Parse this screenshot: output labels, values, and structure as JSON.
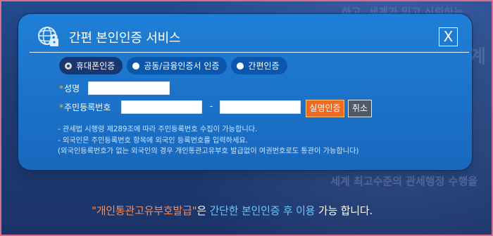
{
  "background": {
    "watermark_top": "하고, 세계가 믿고 신뢰하는",
    "watermark_right": "세계",
    "watermark_bottom": "세계 최고수준의 관세행정 수행을"
  },
  "dialog": {
    "title": "간편 본인인증 서비스",
    "close_label": "X",
    "tabs": [
      {
        "label": "휴대폰인증",
        "selected": true
      },
      {
        "label": "공동/금융인증서 인증",
        "selected": false
      },
      {
        "label": "간편인증",
        "selected": false
      }
    ],
    "fields": {
      "required_mark": "*",
      "name_label": "성명",
      "name_value": "",
      "rrn_label": "주민등록번호",
      "rrn_front_value": "",
      "rrn_separator": "-",
      "rrn_back_value": ""
    },
    "buttons": {
      "verify": "실명인증",
      "cancel": "취소"
    },
    "notes": [
      "- 관세법 시행령 제289조에 따라 주민등록번호 수집이 가능합니다.",
      "- 외국인은 주민등록번호 항목에 외국인 등록번호를 입력하세요.",
      "(외국인등록번호가 없는 외국인의 경우 개인통관고유부호 발급없이 여권번호로도 통관이 가능합니다)"
    ]
  },
  "bottom_message": {
    "highlight": "\"개인통관고유부호발급\"",
    "after_highlight": "은 ",
    "blue_text": "간단한 본인인증 후 이용",
    "end_text": " 가능 합니다."
  },
  "colors": {
    "page_background": "#1f3f78",
    "dialog_background": "#1f7fd6",
    "active_tab": "#18366f",
    "inactive_tab": "#0c57ae",
    "verify_button": "#f06a1f",
    "cancel_button": "#4f5a67",
    "orange_text": "#f38d62",
    "blue_text": "#68c8ff"
  },
  "icons": {
    "header": "globe-lock-icon",
    "close": "close-icon",
    "radio": "radio-icon"
  }
}
